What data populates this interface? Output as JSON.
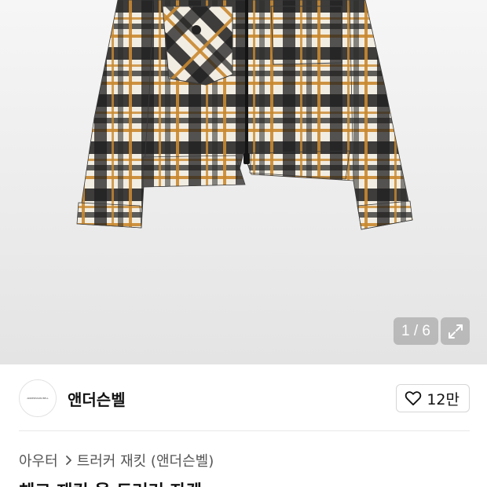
{
  "gallery": {
    "page_indicator": "1 / 6",
    "expand_icon": "expand-icon",
    "colors": {
      "black": "#1b1b1b",
      "mustard": "#c9892f",
      "cream": "#f4efe4",
      "white": "#ffffff"
    }
  },
  "brand": {
    "name": "앤더슨벨",
    "logo_text": "ANDERSSON BELL",
    "like_icon": "heart-outline-icon",
    "like_count": "12만"
  },
  "breadcrumb": {
    "items": [
      "아우터",
      "트러커 재킷 (앤더슨벨)"
    ],
    "separator_icon": "chevron-right-icon"
  },
  "product": {
    "title_partial": "체크 재킷 울 트러커 자켓"
  }
}
